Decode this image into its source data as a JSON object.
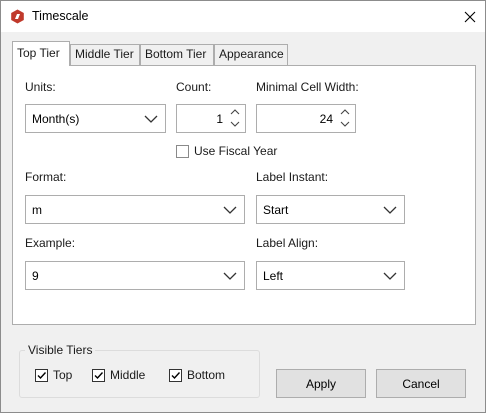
{
  "window": {
    "title": "Timescale",
    "app_icon": "project-app-icon",
    "close_icon": "close-icon"
  },
  "tabs": [
    {
      "label": "Top Tier",
      "active": true
    },
    {
      "label": "Middle Tier",
      "active": false
    },
    {
      "label": "Bottom Tier",
      "active": false
    },
    {
      "label": "Appearance",
      "active": false
    }
  ],
  "form": {
    "units_label": "Units:",
    "units_value": "Month(s)",
    "count_label": "Count:",
    "count_value": "1",
    "min_width_label": "Minimal Cell Width:",
    "min_width_value": "24",
    "fiscal_year_label": "Use Fiscal Year",
    "fiscal_year_checked": false,
    "format_label": "Format:",
    "format_value": "m",
    "label_instant_label": "Label Instant:",
    "label_instant_value": "Start",
    "example_label": "Example:",
    "example_value": "9",
    "label_align_label": "Label Align:",
    "label_align_value": "Left"
  },
  "visible_tiers": {
    "title": "Visible Tiers",
    "items": [
      {
        "label": "Top",
        "checked": true
      },
      {
        "label": "Middle",
        "checked": true
      },
      {
        "label": "Bottom",
        "checked": true
      }
    ]
  },
  "buttons": {
    "apply": "Apply",
    "cancel": "Cancel"
  },
  "colors": {
    "app_icon": "#c0392b",
    "panel": "#ffffff",
    "window": "#f0f0f0"
  }
}
